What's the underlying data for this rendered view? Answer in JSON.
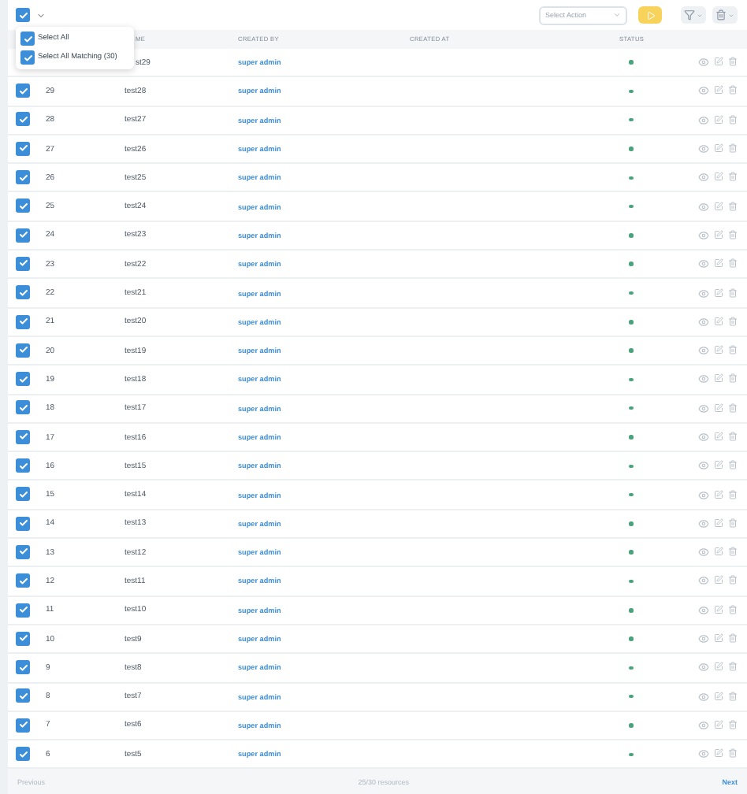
{
  "toolbar": {
    "select_all_checkbox": {
      "checked": true
    },
    "action_select": {
      "placeholder": "Select Action"
    }
  },
  "selection_menu": [
    {
      "label": "Select All",
      "checked": true
    },
    {
      "label": "Select All Matching (30)",
      "checked": true
    }
  ],
  "table": {
    "columns": [
      "ME",
      "CREATED BY",
      "CREATED AT",
      "STATUS"
    ],
    "rows": [
      {
        "id": "",
        "name": "st29",
        "created_by": "super admin"
      },
      {
        "id": "29",
        "name": "test28",
        "created_by": "super admin",
        "checked": true
      },
      {
        "id": "28",
        "name": "test27",
        "created_by": "super admin",
        "checked": true
      },
      {
        "id": "27",
        "name": "test26",
        "created_by": "super admin",
        "checked": true
      },
      {
        "id": "26",
        "name": "test25",
        "created_by": "super admin",
        "checked": true
      },
      {
        "id": "25",
        "name": "test24",
        "created_by": "super admin",
        "checked": true
      },
      {
        "id": "24",
        "name": "test23",
        "created_by": "super admin",
        "checked": true
      },
      {
        "id": "23",
        "name": "test22",
        "created_by": "super admin",
        "checked": true
      },
      {
        "id": "22",
        "name": "test21",
        "created_by": "super admin",
        "checked": true
      },
      {
        "id": "21",
        "name": "test20",
        "created_by": "super admin",
        "checked": true
      },
      {
        "id": "20",
        "name": "test19",
        "created_by": "super admin",
        "checked": true
      },
      {
        "id": "19",
        "name": "test18",
        "created_by": "super admin",
        "checked": true
      },
      {
        "id": "18",
        "name": "test17",
        "created_by": "super admin",
        "checked": true
      },
      {
        "id": "17",
        "name": "test16",
        "created_by": "super admin",
        "checked": true
      },
      {
        "id": "16",
        "name": "test15",
        "created_by": "super admin",
        "checked": true
      },
      {
        "id": "15",
        "name": "test14",
        "created_by": "super admin",
        "checked": true
      },
      {
        "id": "14",
        "name": "test13",
        "created_by": "super admin",
        "checked": true
      },
      {
        "id": "13",
        "name": "test12",
        "created_by": "super admin",
        "checked": true
      },
      {
        "id": "12",
        "name": "test11",
        "created_by": "super admin",
        "checked": true
      },
      {
        "id": "11",
        "name": "test10",
        "created_by": "super admin",
        "checked": true
      },
      {
        "id": "10",
        "name": "test9",
        "created_by": "super admin",
        "checked": true
      },
      {
        "id": "9",
        "name": "test8",
        "created_by": "super admin",
        "checked": true
      },
      {
        "id": "8",
        "name": "test7",
        "created_by": "super admin",
        "checked": true
      },
      {
        "id": "7",
        "name": "test6",
        "created_by": "super admin",
        "checked": true
      },
      {
        "id": "6",
        "name": "test5",
        "created_by": "super admin",
        "checked": true
      }
    ]
  },
  "pagination": {
    "previous": "Previous",
    "info": "25/30 resources",
    "next": "Next"
  }
}
